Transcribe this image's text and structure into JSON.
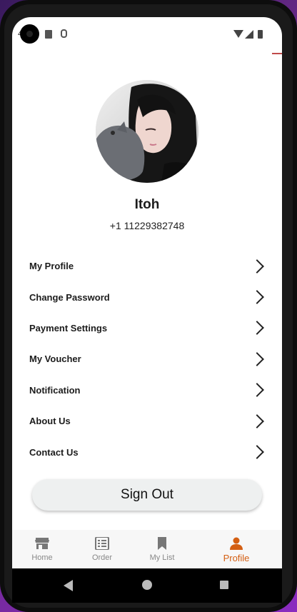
{
  "status_bar": {
    "time": "4"
  },
  "profile": {
    "name": "Itoh",
    "phone": "+1 11229382748"
  },
  "menu": [
    {
      "label": "My Profile"
    },
    {
      "label": "Change Password"
    },
    {
      "label": "Payment Settings"
    },
    {
      "label": "My Voucher"
    },
    {
      "label": "Notification"
    },
    {
      "label": "About Us"
    },
    {
      "label": "Contact Us"
    }
  ],
  "signout_label": "Sign Out",
  "tabs": [
    {
      "label": "Home",
      "icon": "store-icon"
    },
    {
      "label": "Order",
      "icon": "list-icon"
    },
    {
      "label": "My List",
      "icon": "bookmark-icon"
    },
    {
      "label": "Profile",
      "icon": "person-icon",
      "active": true
    }
  ],
  "colors": {
    "accent": "#d45f13",
    "inactive": "#888888"
  }
}
